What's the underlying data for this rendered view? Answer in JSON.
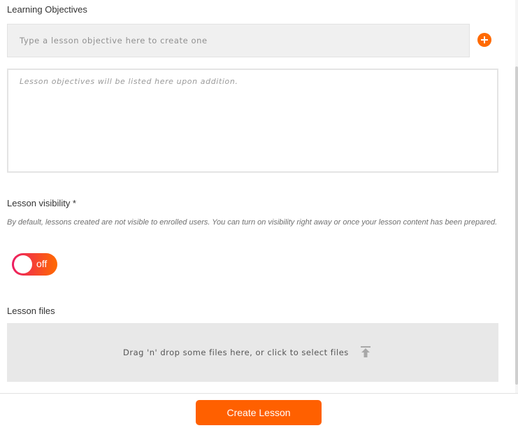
{
  "objectives": {
    "label": "Learning Objectives",
    "input_placeholder": "Type a lesson objective here to create one",
    "input_value": "",
    "add_icon": "plus-circle-icon",
    "empty_text": "Lesson objectives will be listed here upon addition."
  },
  "visibility": {
    "label": "Lesson visibility *",
    "description": "By default, lessons created are not visible to enrolled users. You can turn on visibility right away or once your lesson content has been prepared.",
    "toggle_text": "off",
    "toggle_state": false
  },
  "files": {
    "label": "Lesson files",
    "dropzone_text": "Drag 'n' drop some files here, or click to select files",
    "upload_icon": "upload-icon"
  },
  "footer": {
    "create_label": "Create Lesson"
  },
  "colors": {
    "accent": "#ff6000",
    "toggle_gradient_start": "#ec1d63",
    "toggle_gradient_end": "#ff6a00"
  }
}
